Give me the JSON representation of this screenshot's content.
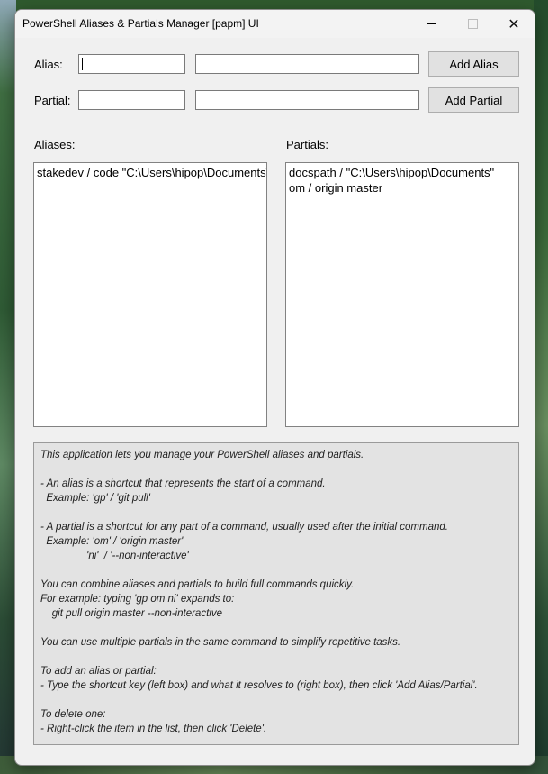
{
  "window": {
    "title": "PowerShell Aliases & Partials Manager [papm] UI",
    "controls": {
      "minimize_icon": "minimize-icon",
      "maximize_icon": "maximize-icon",
      "close_icon": "✕"
    }
  },
  "alias_row": {
    "label": "Alias:",
    "key_value": "",
    "resolve_value": "",
    "button_label": "Add Alias"
  },
  "partial_row": {
    "label": "Partial:",
    "key_value": "",
    "resolve_value": "",
    "button_label": "Add Partial"
  },
  "aliases": {
    "heading": "Aliases:",
    "items": [
      "stakedev / code \"C:\\Users\\hipop\\Documents\\"
    ]
  },
  "partials": {
    "heading": "Partials:",
    "items": [
      "docspath / \"C:\\Users\\hipop\\Documents\"",
      "om / origin master"
    ]
  },
  "help": {
    "lines": [
      "This application lets you manage your PowerShell aliases and partials.",
      "",
      "- An alias is a shortcut that represents the start of a command.",
      "  Example: 'gp' / 'git pull'",
      "",
      "- A partial is a shortcut for any part of a command, usually used after the initial command.",
      "  Example: 'om' / 'origin master'",
      "                'ni'  / '--non-interactive'",
      "",
      "You can combine aliases and partials to build full commands quickly.",
      "For example: typing 'gp om ni' expands to:",
      "    git pull origin master --non-interactive",
      "",
      "You can use multiple partials in the same command to simplify repetitive tasks.",
      "",
      "To add an alias or partial:",
      "- Type the shortcut key (left box) and what it resolves to (right box), then click 'Add Alias/Partial'.",
      "",
      "To delete one:",
      "- Right-click the item in the list, then click 'Delete'."
    ]
  }
}
